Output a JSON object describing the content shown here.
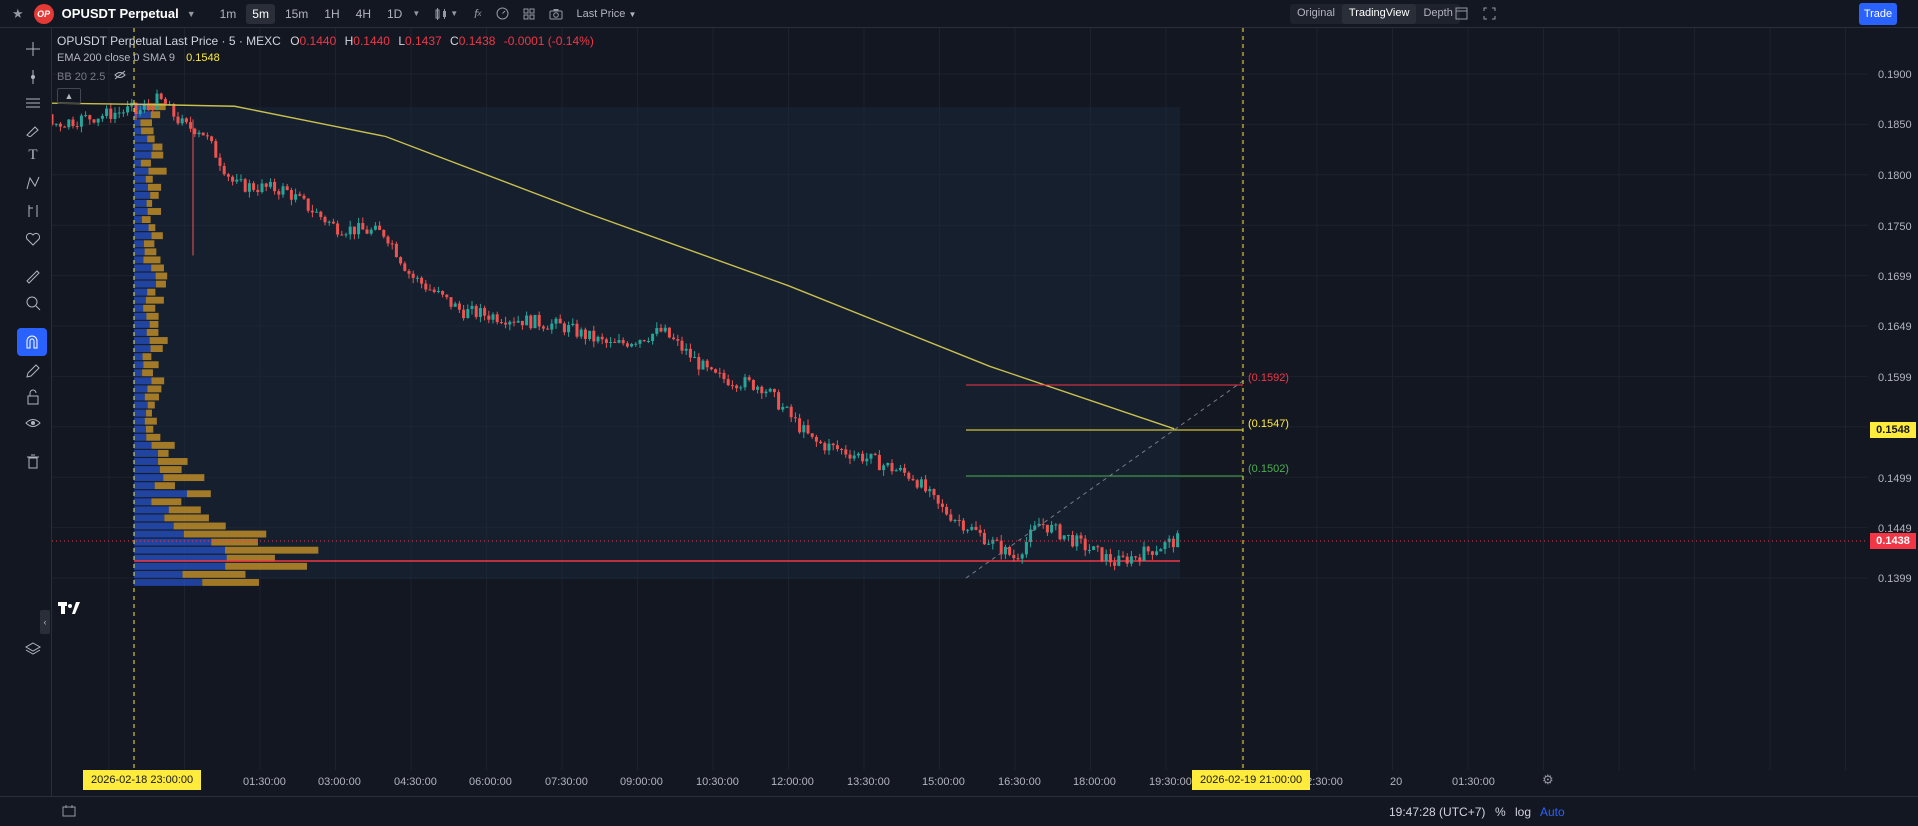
{
  "header": {
    "logo_text": "OP",
    "symbol": "OPUSDT Perpetual",
    "timeframes": [
      "1m",
      "5m",
      "15m",
      "1H",
      "4H",
      "1D"
    ],
    "active_timeframe": "5m",
    "price_type": "Last Price",
    "views": [
      "Original",
      "TradingView",
      "Depth"
    ],
    "active_view": "TradingView",
    "trade_label": "Trade"
  },
  "legend": {
    "title": "OPUSDT Perpetual Last Price · 5 · MEXC",
    "o_label": "O",
    "o": "0.1440",
    "h_label": "H",
    "h": "0.1440",
    "l_label": "L",
    "l": "0.1437",
    "c_label": "C",
    "c": "0.1438",
    "change": "-0.0001 (-0.14%)",
    "ema_label": "EMA 200 close 0 SMA 9",
    "ema_value": "0.1548",
    "bb_label": "BB 20 2.5"
  },
  "price_axis": {
    "labels": [
      "0.1900",
      "0.1850",
      "0.1800",
      "0.1750",
      "0.1699",
      "0.1649",
      "0.1599",
      "0.1499",
      "0.1449",
      "0.1399"
    ],
    "ema_tag": "0.1548",
    "last_tag": "0.1438"
  },
  "levels": {
    "upper": "(0.1592)",
    "middle": "(0.1547)",
    "lower": "(0.1502)"
  },
  "time_axis": {
    "labels": [
      "01:30:00",
      "03:00:00",
      "04:30:00",
      "06:00:00",
      "07:30:00",
      "09:00:00",
      "10:30:00",
      "12:00:00",
      "13:30:00",
      "15:00:00",
      "16:30:00",
      "18:00:00",
      "19:30:00",
      "22:30:00",
      "20",
      "01:30:00"
    ],
    "partial_label": "9",
    "cursor_left": "2026-02-18   23:00:00",
    "cursor_right": "2026-02-19   21:00:00"
  },
  "footer": {
    "clock": "19:47:28 (UTC+7)",
    "percent": "%",
    "log": "log",
    "auto": "Auto"
  },
  "chart_data": {
    "type": "candlestick",
    "x_range": [
      "2026-02-18 23:00",
      "2026-02-19 19:45"
    ],
    "ylim": [
      0.137,
      0.192
    ],
    "ema200": {
      "name": "EMA 200",
      "x": [
        "2026-02-18 23:00",
        "2026-02-19 01:00",
        "2026-02-19 04:00",
        "2026-02-19 08:00",
        "2026-02-19 12:00",
        "2026-02-19 16:00",
        "2026-02-19 19:40"
      ],
      "values": [
        0.187,
        0.1868,
        0.1838,
        0.1762,
        0.169,
        0.161,
        0.1548
      ]
    },
    "price_path": {
      "x": [
        "2026-02-18 23:00",
        "2026-02-18 23:30",
        "2026-02-19 00:00",
        "2026-02-19 00:20",
        "2026-02-19 01:00",
        "2026-02-19 02:00",
        "2026-02-19 03:00",
        "2026-02-19 04:00",
        "2026-02-19 04:30",
        "2026-02-19 05:30",
        "2026-02-19 07:30",
        "2026-02-19 08:30",
        "2026-02-19 09:30",
        "2026-02-19 10:30",
        "2026-02-19 11:30",
        "2026-02-19 12:30",
        "2026-02-19 13:30",
        "2026-02-19 14:30",
        "2026-02-19 15:00",
        "2026-02-19 16:30",
        "2026-02-19 17:00",
        "2026-02-19 18:30",
        "2026-02-19 19:45"
      ],
      "values": [
        0.186,
        0.1875,
        0.1848,
        0.1845,
        0.179,
        0.1785,
        0.1748,
        0.1742,
        0.17,
        0.1665,
        0.165,
        0.163,
        0.1645,
        0.16,
        0.159,
        0.1535,
        0.152,
        0.15,
        0.147,
        0.142,
        0.1455,
        0.1415,
        0.1438
      ]
    },
    "volume_profile_poc": 0.1418
  }
}
